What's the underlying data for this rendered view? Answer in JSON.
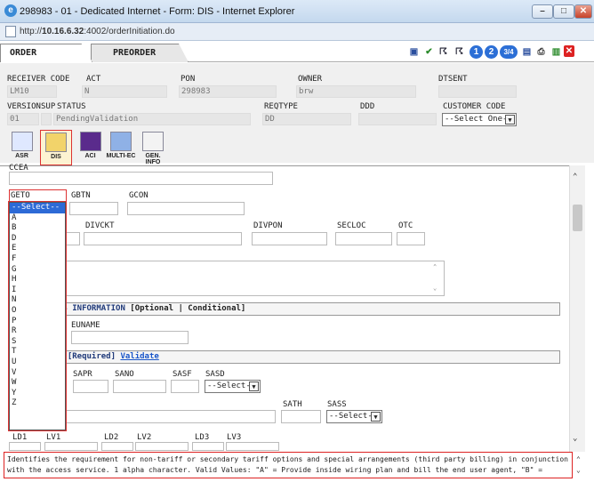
{
  "window": {
    "title": "298983 - 01 - Dedicated Internet - Form: DIS - Internet Explorer",
    "url_prefix": "http://",
    "url_host": "10.16.6.32",
    "url_path": ":4002/orderInitiation.do"
  },
  "tabs": {
    "order": "ORDER",
    "preorder": "PREORDER"
  },
  "toolbar": {
    "n1": "1",
    "n2": "2",
    "n34": "3/4"
  },
  "header": {
    "receiver_code_label": "RECEIVER CODE",
    "receiver_code": "LM10",
    "act_label": "ACT",
    "act": "N",
    "pon_label": "PON",
    "pon": "298983",
    "owner_label": "OWNER",
    "owner": "brw",
    "dtsent_label": "DTSENT",
    "dtsent": "",
    "version_label": "VERSION",
    "version": "01",
    "sup_label": "SUP",
    "status_label": "STATUS",
    "status": "PendingValidation",
    "reqtype_label": "REQTYPE",
    "reqtype": "DD",
    "ddd_label": "DDD",
    "ddd": "",
    "customer_code_label": "CUSTOMER CODE",
    "customer_code": "--Select One--"
  },
  "form_icons": {
    "asr": "ASR",
    "dis": "DIS",
    "aci": "ACI",
    "multi_ec": "MULTI-EC",
    "gen_info": "GEN. INFO"
  },
  "form": {
    "ccea_label": "CCEA",
    "geto_label": "GETO",
    "gbtn_label": "GBTN",
    "gcon_label": "GCON",
    "divckt_label": "DIVCKT",
    "divpon_label": "DIVPON",
    "secloc_label": "SECLOC",
    "otc_label": "OTC",
    "section1_title": "SS INFORMATION",
    "section1_opt": "[Optional | Conditional]",
    "euname_label": "EUNAME",
    "section2_title": "L [Required]",
    "section2_link": "Validate",
    "sapr_label": "SAPR",
    "sano_label": "SANO",
    "sasf_label": "SASF",
    "sasd_label": "SASD",
    "sasd_value": "--Select--",
    "sath_label": "SATH",
    "sass_label": "SASS",
    "sass_value": "--Select--",
    "ld1": "LD1",
    "lv1": "LV1",
    "ld2": "LD2",
    "lv2": "LV2",
    "ld3": "LD3",
    "lv3": "LV3"
  },
  "geto_options": [
    "--Select--",
    "A",
    "B",
    "D",
    "E",
    "F",
    "G",
    "H",
    "I",
    "N",
    "O",
    "P",
    "R",
    "S",
    "T",
    "U",
    "V",
    "W",
    "Y",
    "Z"
  ],
  "help_text": "Identifies the requirement for non-tariff or secondary tariff options and special arrangements (third party billing) in conjunction with the access service. 1 alpha character. Valid Values: \"A\" = Provide inside wiring plan and bill the end user agent, \"B\" = Provide site conditioning and bill the customer, \"D\" = Provide"
}
